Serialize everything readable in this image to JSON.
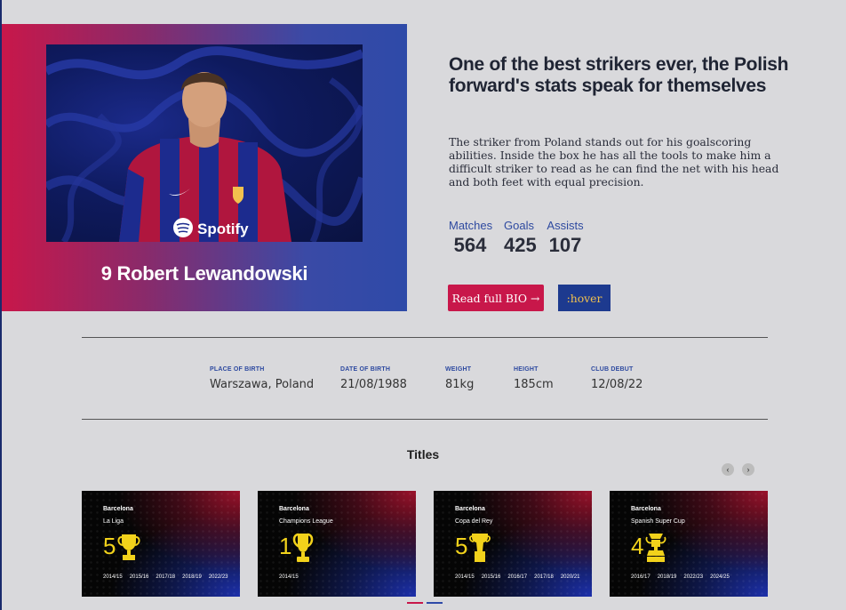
{
  "hero": {
    "player_name": "9 Robert Lewandowski",
    "sponsor": "Spotify"
  },
  "headline": "One of the best strikers ever, the Polish forward's stats speak for themselves",
  "description": "The striker from Poland stands out for his goalscoring abilities. Inside the box he has all the tools to make him a difficult striker to read as he can find the net with his head and both feet with equal precision.",
  "stats": [
    {
      "label": "Matches",
      "value": "564"
    },
    {
      "label": "Goals",
      "value": "425"
    },
    {
      "label": "Assists",
      "value": "107"
    }
  ],
  "buttons": {
    "bio": "Read full BIO →",
    "hover": ":hover"
  },
  "facts": [
    {
      "label": "PLACE OF BIRTH",
      "value": "Warszawa, Poland"
    },
    {
      "label": "DATE OF BIRTH",
      "value": "21/08/1988"
    },
    {
      "label": "WEIGHT",
      "value": "81kg"
    },
    {
      "label": "HEIGHT",
      "value": "185cm"
    },
    {
      "label": "CLUB DEBUT",
      "value": "12/08/22"
    }
  ],
  "titles": {
    "heading": "Titles",
    "prev_icon": "chevron-left-icon",
    "next_icon": "chevron-right-icon",
    "cards": [
      {
        "club": "Barcelona",
        "competition": "La Liga",
        "count": "5",
        "trophy": "la-liga-trophy-icon",
        "years": [
          "2014/15",
          "2015/16",
          "2017/18",
          "2018/19",
          "2022/23"
        ]
      },
      {
        "club": "Barcelona",
        "competition": "Champions League",
        "count": "1",
        "trophy": "champions-league-trophy-icon",
        "years": [
          "2014/15"
        ]
      },
      {
        "club": "Barcelona",
        "competition": "Copa del Rey",
        "count": "5",
        "trophy": "copa-del-rey-trophy-icon",
        "years": [
          "2014/15",
          "2015/16",
          "2016/17",
          "2017/18",
          "2020/21"
        ]
      },
      {
        "club": "Barcelona",
        "competition": "Spanish Super Cup",
        "count": "4",
        "trophy": "super-cup-trophy-icon",
        "years": [
          "2016/17",
          "2018/19",
          "2022/23",
          "2024/25"
        ]
      }
    ]
  },
  "colors": {
    "accent_red": "#c8174a",
    "accent_blue": "#1d3a8f",
    "trophy_gold": "#f2d21b"
  }
}
